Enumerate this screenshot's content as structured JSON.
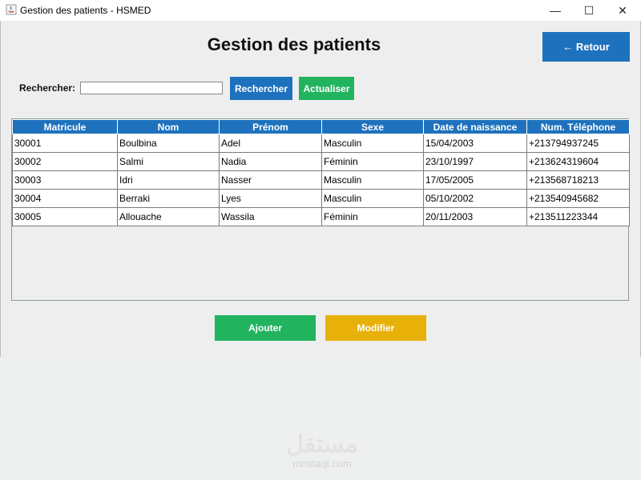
{
  "window": {
    "title": "Gestion des patients - HSMED",
    "minimize_glyph": "—",
    "maximize_glyph": "☐",
    "close_glyph": "✕"
  },
  "header": {
    "title": "Gestion des patients",
    "back_label": "← Retour"
  },
  "search": {
    "label": "Rechercher:",
    "value": "",
    "button_label": "Rechercher",
    "refresh_label": "Actualiser"
  },
  "table": {
    "columns": [
      "Matricule",
      "Nom",
      "Prénom",
      "Sexe",
      "Date de naissance",
      "Num. Téléphone"
    ],
    "rows": [
      [
        "30001",
        "Boulbina",
        "Adel",
        "Masculin",
        "15/04/2003",
        "+213794937245"
      ],
      [
        "30002",
        "Salmi",
        "Nadia",
        "Féminin",
        "23/10/1997",
        "+213624319604"
      ],
      [
        "30003",
        "Idri",
        "Nasser",
        "Masculin",
        "17/05/2005",
        "+213568718213"
      ],
      [
        "30004",
        "Berraki",
        "Lyes",
        "Masculin",
        "05/10/2002",
        "+213540945682"
      ],
      [
        "30005",
        "Allouache",
        "Wassila",
        "Féminin",
        "20/11/2003",
        "+213511223344"
      ]
    ]
  },
  "actions": {
    "add_label": "Ajouter",
    "edit_label": "Modifier"
  },
  "watermark": {
    "arabic": "مستقل",
    "latin": "mostaql.com"
  },
  "colors": {
    "primary_blue": "#1e72bd",
    "success_green": "#22b35f",
    "warning_yellow": "#e8b10a"
  }
}
